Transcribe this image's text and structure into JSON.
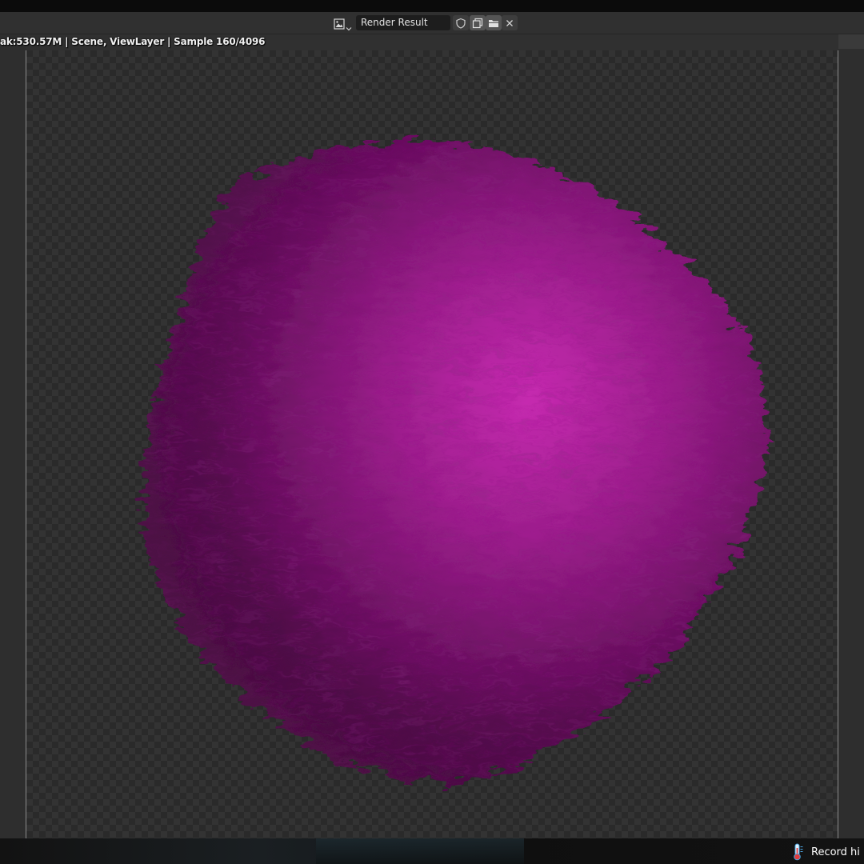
{
  "header": {
    "image_name": "Render Result",
    "image_type_icon": "image-icon",
    "buttons": [
      "fake-user-icon",
      "new-image-icon",
      "open-folder-icon",
      "close-icon"
    ]
  },
  "viewport": {
    "render_stats": "ak:530.57M | Scene, ViewLayer | Sample 160/4096"
  },
  "taskbar": {
    "tray_item_label": "Record hi",
    "tray_icon": "thermometer-icon"
  },
  "colors": {
    "fur_main": "#8e1a7e",
    "fur_highlight": "#c62ab0",
    "fur_shadow": "#4a0c42",
    "checker_dark": "#2a2a2a",
    "checker_light": "#333333",
    "header_bg": "#303030"
  }
}
